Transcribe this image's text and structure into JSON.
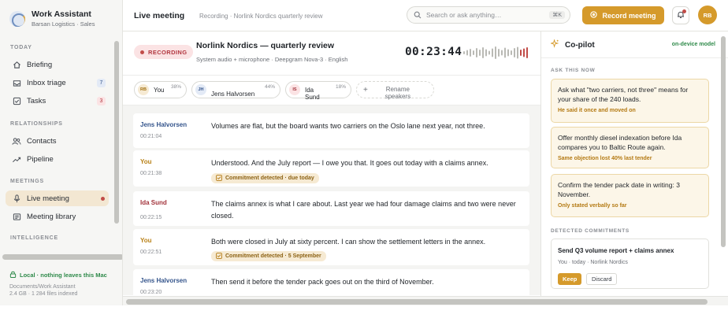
{
  "brand": {
    "name": "Work Assistant",
    "org": "Barsan Logistics · Sales"
  },
  "sidebar": {
    "sections": [
      {
        "title": "Today",
        "items": [
          {
            "label": "Briefing",
            "icon": "home-icon"
          },
          {
            "label": "Inbox triage",
            "icon": "inbox-icon",
            "badge": "7"
          },
          {
            "label": "Tasks",
            "icon": "checkbox-icon",
            "badge": "3"
          }
        ]
      },
      {
        "title": "Relationships",
        "items": [
          {
            "label": "Contacts",
            "icon": "people-icon"
          },
          {
            "label": "Pipeline",
            "icon": "trend-icon"
          }
        ]
      },
      {
        "title": "Meetings",
        "items": [
          {
            "label": "Live meeting",
            "icon": "mic-icon",
            "active": true
          },
          {
            "label": "Meeting library",
            "icon": "library-icon"
          }
        ]
      },
      {
        "title": "Intelligence",
        "items": []
      }
    ],
    "local_status": "Local · nothing leaves this Mac",
    "local_path": "Documents/Work Assistant",
    "local_stats": "2.4 GB · 1 284 files indexed"
  },
  "topbar": {
    "title": "Live meeting",
    "breadcrumb": "Recording · Norlink Nordics quarterly review",
    "search_placeholder": "Search or ask anything…",
    "search_shortcut": "⌘K",
    "record_label": "Record meeting",
    "avatar": "RB"
  },
  "meeting": {
    "status": "RECORDING",
    "title": "Norlink Nordics — quarterly review",
    "subtitle": "System audio + microphone · Deepgram Nova-3 · English",
    "timer": "00:23:44",
    "colors": {
      "accent": "#d59a2b",
      "recording": "#c14c48"
    }
  },
  "speakers": [
    {
      "initials": "RB",
      "name": "You",
      "pct": "38%"
    },
    {
      "initials": "JH",
      "name": "Jens Halvorsen",
      "pct": "44%"
    },
    {
      "initials": "IS",
      "name": "Ida Sund",
      "pct": "18%"
    }
  ],
  "rename_label": "Rename speakers",
  "transcript": [
    {
      "speaker": "Jens Halvorsen",
      "time": "00:21:04",
      "text": "Volumes are flat, but the board wants two carriers on the Oslo lane next year, not three."
    },
    {
      "speaker": "You",
      "time": "00:21:38",
      "text": "Understood. And the July report — I owe you that. It goes out today with a claims annex.",
      "tag": "Commitment detected · due today"
    },
    {
      "speaker": "Ida Sund",
      "time": "00:22:15",
      "text": "The claims annex is what I care about. Last year we had four damage claims and two were never closed."
    },
    {
      "speaker": "You",
      "time": "00:22:51",
      "text": "Both were closed in July at sixty percent. I can show the settlement letters in the annex.",
      "tag": "Commitment detected · 5 September"
    },
    {
      "speaker": "Jens Halvorsen",
      "time": "00:23:20",
      "text": "Then send it before the tender pack goes out on the third of November."
    }
  ],
  "copilot": {
    "title": "Co-pilot",
    "badge": "on-device model",
    "ask_title": "Ask this now",
    "asks": [
      {
        "q": "Ask what \"two carriers, not three\" means for your share of the 240 loads.",
        "note": "He said it once and moved on"
      },
      {
        "q": "Offer monthly diesel indexation before Ida compares you to Baltic Route again.",
        "note": "Same objection lost 40% last tender"
      },
      {
        "q": "Confirm the tender pack date in writing: 3 November.",
        "note": "Only stated verbally so far"
      }
    ],
    "commit_title": "Detected commitments",
    "commitment": {
      "title": "Send Q3 volume report + claims annex",
      "meta": "You · today · Norlink Nordics",
      "keep": "Keep",
      "discard": "Discard"
    }
  }
}
